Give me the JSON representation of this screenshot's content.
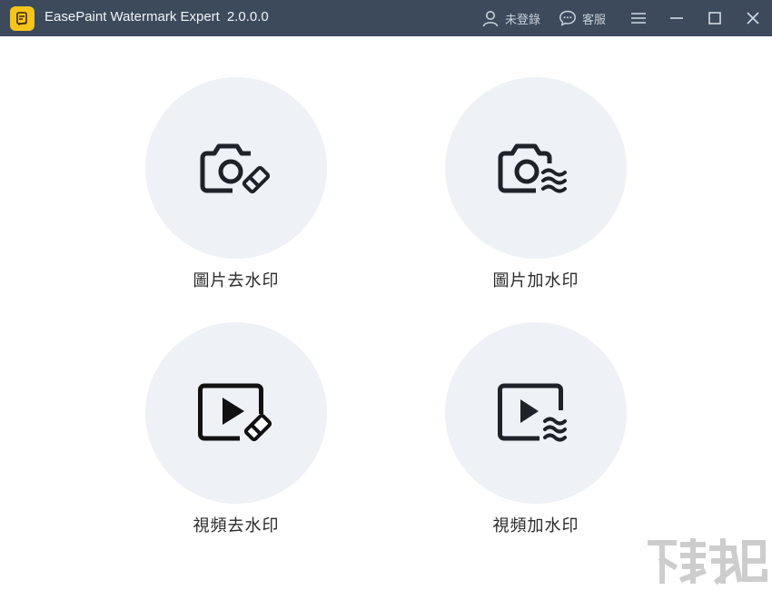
{
  "titlebar": {
    "app_name": "EasePaint Watermark Expert",
    "version": "2.0.0.0",
    "login_label": "未登錄",
    "support_label": "客服",
    "icons": {
      "logo": "app-logo-icon",
      "login": "user-icon",
      "support": "chat-icon",
      "menu": "menu-icon",
      "minimize": "minimize-icon",
      "maximize": "maximize-icon",
      "close": "close-icon"
    }
  },
  "main": {
    "features": [
      {
        "label": "圖片去水印",
        "icon": "camera-eraser-icon"
      },
      {
        "label": "圖片加水印",
        "icon": "camera-waves-icon"
      },
      {
        "label": "視頻去水印",
        "icon": "video-eraser-icon"
      },
      {
        "label": "視頻加水印",
        "icon": "video-waves-icon"
      }
    ]
  },
  "colors": {
    "titlebar_bg": "#3c4a5c",
    "circle_bg": "#eef1f5",
    "logo_yellow": "#f5c51b",
    "icon_dark": "#1f2329"
  }
}
